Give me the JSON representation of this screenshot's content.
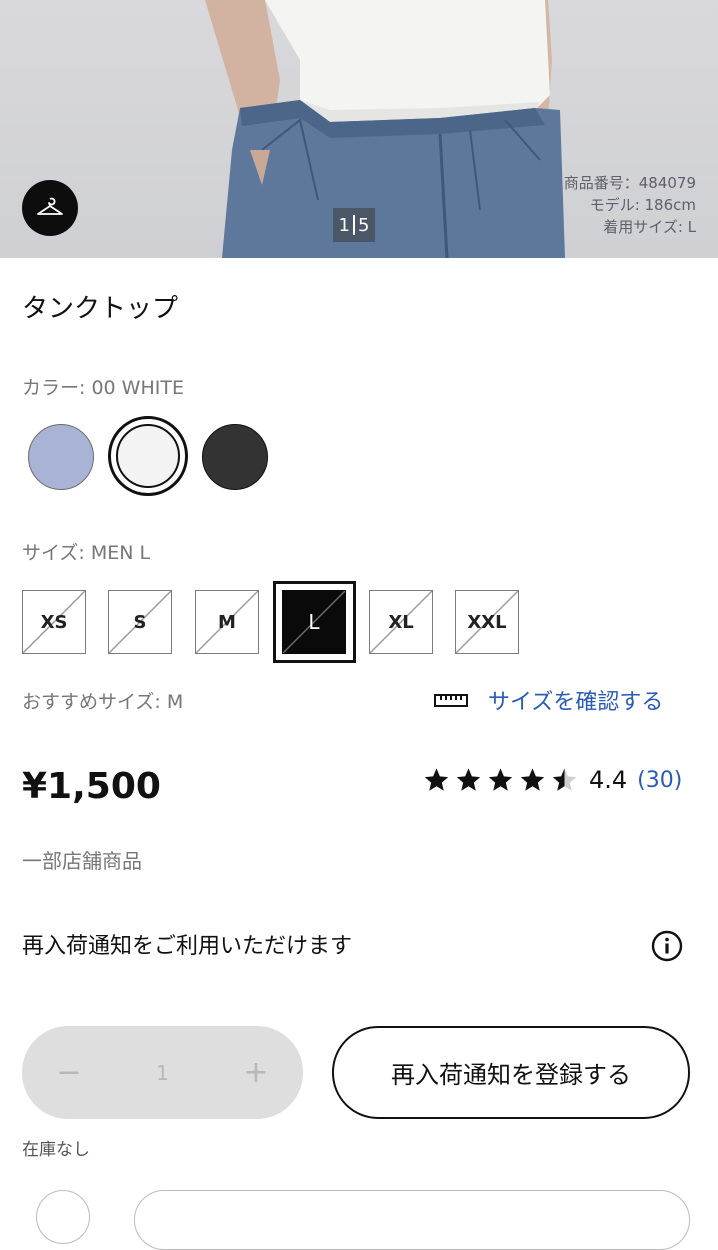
{
  "hero": {
    "page_current": "1",
    "page_total": "5",
    "model_info": [
      "商品番号：484079",
      "モデル: 186cm",
      "着用サイズ: L"
    ]
  },
  "product": {
    "title": "タンクトップ",
    "color_label": "カラー: 00 WHITE",
    "colors": [
      {
        "name": "blue",
        "hex": "#a9b3d6"
      },
      {
        "name": "00 WHITE",
        "hex": "#f3f3f3",
        "selected": true
      },
      {
        "name": "black",
        "hex": "#333333"
      }
    ],
    "size_label": "サイズ: MEN L",
    "sizes": [
      {
        "label": "XS",
        "available": false
      },
      {
        "label": "S",
        "available": false
      },
      {
        "label": "M",
        "available": false
      },
      {
        "label": "L",
        "available": false,
        "selected": true
      },
      {
        "label": "XL",
        "available": false
      },
      {
        "label": "XXL",
        "available": false
      }
    ],
    "recommended_size": "おすすめサイズ: M",
    "check_size_link": "サイズを確認する",
    "price": "¥1,500",
    "rating": {
      "value": "4.4",
      "count": "(30)",
      "stars": 4.4
    },
    "store_only": "一部店舗商品",
    "restock_note": "再入荷通知をご利用いただけます",
    "quantity": "1",
    "notify_button": "再入荷通知を登録する",
    "stock_status": "在庫なし"
  },
  "colors": {
    "link": "#2a5bb5",
    "text_muted": "#777777",
    "qty_bg": "#dedede"
  },
  "icons": [
    "hanger-icon",
    "ruler-icon",
    "star-icon",
    "info-icon",
    "minus-icon",
    "plus-icon"
  ]
}
